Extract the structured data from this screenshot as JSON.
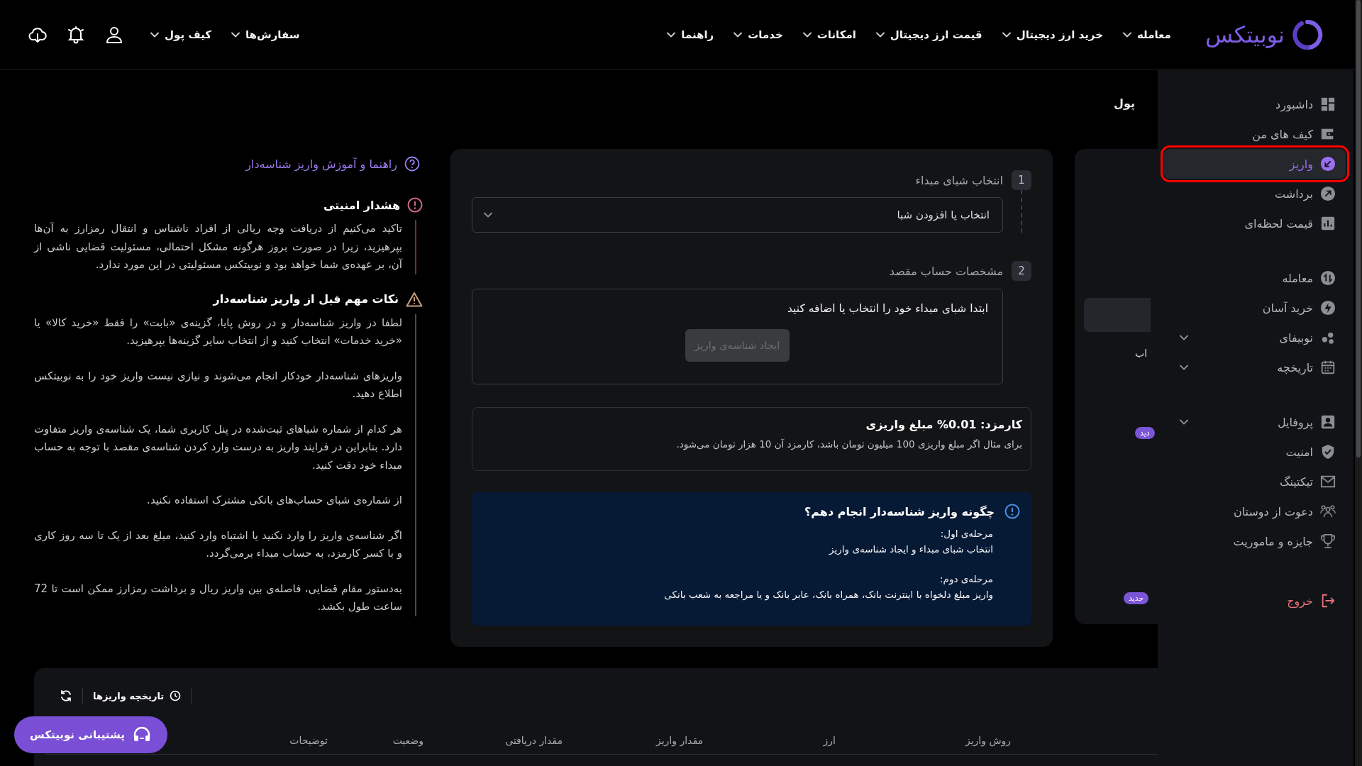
{
  "header": {
    "logo": "نوبیتکس",
    "nav": [
      "معامله",
      "خرید ارز دیجیتال",
      "قیمت ارز دیجیتال",
      "امکانات",
      "خدمات",
      "راهنما"
    ],
    "menus": [
      "سفارش‌ها",
      "کیف پول"
    ]
  },
  "page_title": "پول",
  "help_link": "راهنما و آموزش واریز شناسه‌دار",
  "notices": [
    {
      "kind": "danger",
      "title": "هشدار امنیتی",
      "paragraphs": [
        "تاکید می‌کنیم از دریافت وجه ریالی از افراد ناشناس و انتقال رمزارز به آن‌ها بپرهیزید، زیرا در صورت بروز هرگونه مشکل احتمالی، مسئولیت قضایی ناشی از آن، بر عهده‌ی شما خواهد بود و نوبیتکس مسئولیتی در این مورد ندارد."
      ]
    },
    {
      "kind": "warning",
      "title": "نکات مهم قبل از واریز شناسه‌دار",
      "paragraphs": [
        "لطفا در واریز شناسه‌دار و در روش پایا، گزینه‌ی «بابت» را فقط «خرید کالا» یا «خرید خدمات» انتخاب کنید و از انتخاب سایر گزینه‌ها بپرهیزید.",
        "واریزهای شناسه‌دار خودکار انجام می‌شوند و نیازی نیست واریز خود را به نوبیتکس اطلاع دهید.",
        "هر کدام از شماره شباهای ثبت‌شده در پنل کاربری شما، یک شناسه‌ی واریز متفاوت دارد. بنابراین در فرایند واریز به درست وارد کردن شناسه‌ی مقصد با توجه به حساب مبداء خود دقت کنید.",
        "از شماره‌ی شبای حساب‌های بانکی مشترک استفاده نکنید.",
        "اگر شناسه‌ی واریز را وارد نکنید یا اشتباه وارد کنید، مبلغ بعد از یک تا سه روز کاری و با کسر کارمزد، به حساب مبداء برمی‌گردد.",
        "به‌دستور مقام قضایی، فاصله‌ی بین واریز ریال و برداشت رمزارز ممکن است تا 72 ساعت طول بکشد."
      ]
    }
  ],
  "deposit_form": {
    "steps": [
      {
        "number": "1",
        "title": "انتخاب شبای مبداء",
        "select": {
          "label": "انتخاب یا افزودن شبا"
        }
      },
      {
        "number": "2",
        "title": "مشخصات حساب مقصد",
        "message": "ابتدا شبای مبداء خود را انتخاب یا اضافه کنید",
        "button": {
          "label": "ایجاد شناسه‌ی واریز",
          "disabled": true
        }
      }
    ],
    "fee": {
      "title": "کارمزد: 0.01% مبلغ واریزی",
      "note": "برای مثال اگر مبلغ واریزی 100 میلیون تومان باشد، کارمزد آن 10 هزار تومان می‌شود."
    },
    "guide": {
      "title": "چگونه واریز شناسه‌دار انجام دهم؟",
      "stages": [
        {
          "label": "مرحله‌ی اول:",
          "text": "انتخاب شبای مبداء و ایجاد شناسه‌ی واریز"
        },
        {
          "label": "مرحله‌ی دوم:",
          "text": "واریز مبلغ دلخواه با اینترنت بانک، همراه بانک، عابر بانک و یا مراجعه به شعب بانکی"
        }
      ]
    }
  },
  "side_panel": {
    "text": "اب",
    "badges": [
      "دید",
      "جدید"
    ]
  },
  "sidebar": {
    "groups": [
      {
        "items": [
          {
            "label": "داشبورد",
            "selected": false,
            "expandable": false
          },
          {
            "label": "کیف های من",
            "selected": false,
            "expandable": false
          },
          {
            "label": "واریز",
            "selected": true,
            "expandable": false
          },
          {
            "label": "برداشت",
            "selected": false,
            "expandable": false
          },
          {
            "label": "قیمت لحظه‌ای",
            "selected": false,
            "expandable": false
          }
        ]
      },
      {
        "items": [
          {
            "label": "معامله",
            "selected": false,
            "expandable": false
          },
          {
            "label": "خرید آسان",
            "selected": false,
            "expandable": false
          },
          {
            "label": "نوبیفای",
            "selected": false,
            "expandable": true
          },
          {
            "label": "تاریخچه",
            "selected": false,
            "expandable": true
          }
        ]
      },
      {
        "items": [
          {
            "label": "پروفایل",
            "selected": false,
            "expandable": true
          },
          {
            "label": "امنیت",
            "selected": false,
            "expandable": false
          },
          {
            "label": "تیکتینگ",
            "selected": false,
            "expandable": false
          },
          {
            "label": "دعوت از دوستان",
            "selected": false,
            "expandable": false
          },
          {
            "label": "جایزه و ماموریت",
            "selected": false,
            "expandable": false
          }
        ]
      }
    ],
    "logout": "خروج"
  },
  "history": {
    "tab": "تاریخچه واریزها",
    "columns": [
      "روش واریز",
      "ارز",
      "مقدار واریز",
      "مقدار دریافتی",
      "وضعیت",
      "توضیحات"
    ]
  },
  "support_button": "پشتیبانی نوبیتکس"
}
